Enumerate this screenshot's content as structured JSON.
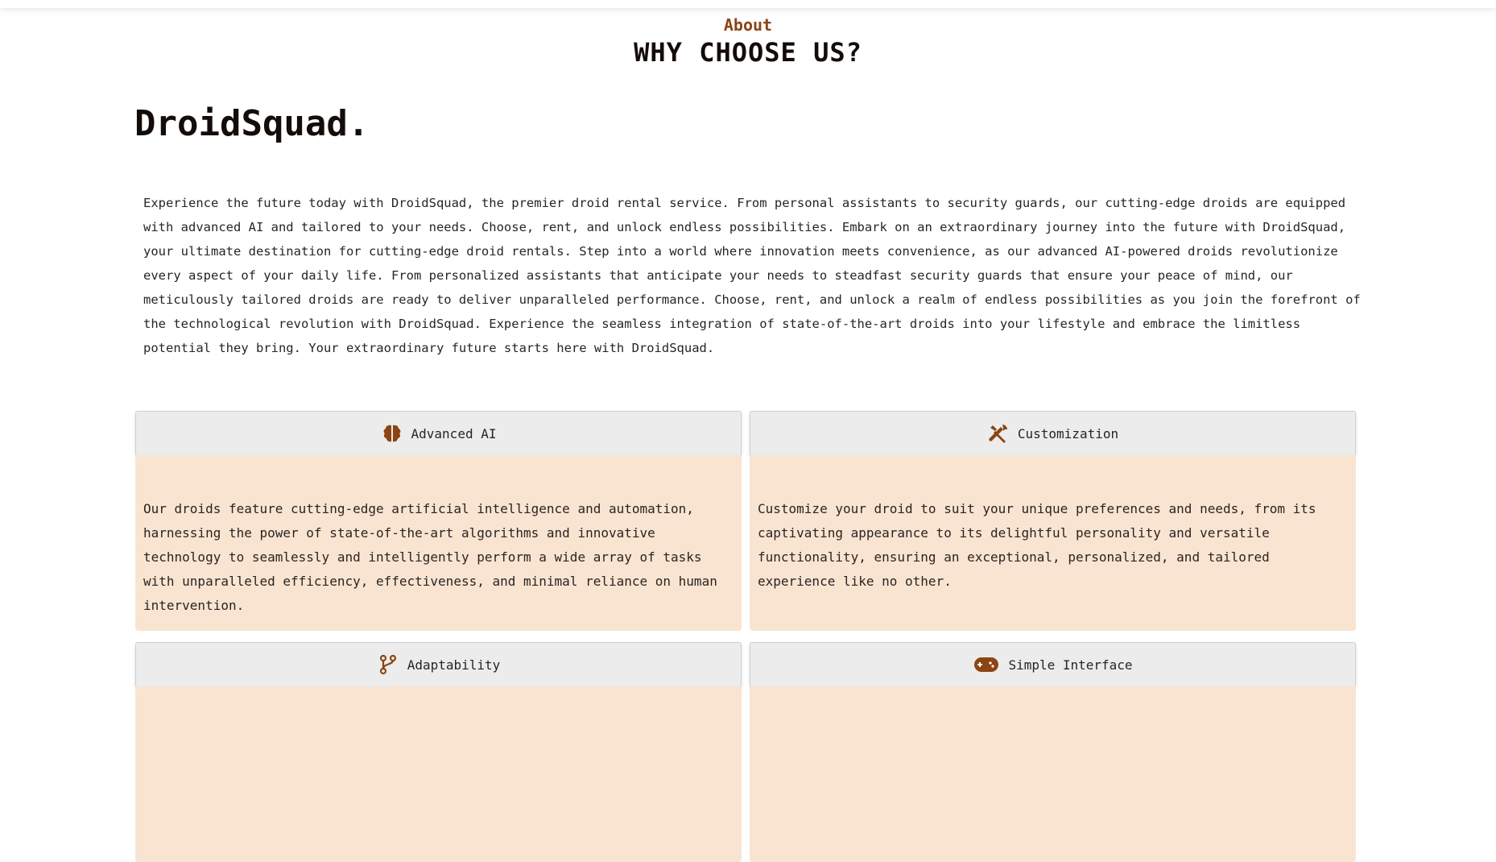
{
  "header": {
    "eyebrow": "About",
    "title": "WHY CHOOSE US?"
  },
  "brand": "DroidSquad.",
  "intro": "Experience the future today with DroidSquad, the premier droid rental service. From personal assistants to security guards, our cutting-edge droids are equipped with advanced AI and tailored to your needs. Choose, rent, and unlock endless possibilities. Embark on an extraordinary journey into the future with DroidSquad, your ultimate destination for cutting-edge droid rentals. Step into a world where innovation meets convenience, as our advanced AI-powered droids revolutionize every aspect of your daily life. From personalized assistants that anticipate your needs to steadfast security guards that ensure your peace of mind, our meticulously tailored droids are ready to deliver unparalleled performance. Choose, rent, and unlock a realm of endless possibilities as you join the forefront of the technological revolution with DroidSquad. Experience the seamless integration of state-of-the-art droids into your lifestyle and embrace the limitless potential they bring. Your extraordinary future starts here with DroidSquad.",
  "features": [
    {
      "title": "Advanced AI",
      "icon": "brain-icon",
      "text": "Our droids feature cutting-edge artificial intelligence and automation, harnessing the power of state-of-the-art algorithms and innovative technology to seamlessly and intelligently perform a wide array of tasks with unparalleled efficiency, effectiveness, and minimal reliance on human intervention."
    },
    {
      "title": "Customization",
      "icon": "tools-icon",
      "text": "Customize your droid to suit your unique preferences and needs, from its captivating appearance to its delightful personality and versatile functionality, ensuring an exceptional, personalized, and tailored experience like no other."
    },
    {
      "title": "Adaptability",
      "icon": "code-branch-icon",
      "text": ""
    },
    {
      "title": "Simple Interface",
      "icon": "gamepad-icon",
      "text": ""
    }
  ],
  "colors": {
    "accent": "#8b4513",
    "card_body": "#f9e4d2",
    "card_header": "#ececec"
  }
}
